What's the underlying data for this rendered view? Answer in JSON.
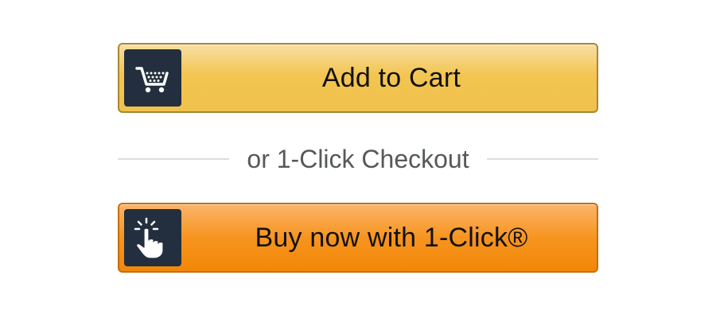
{
  "add_to_cart": {
    "label": "Add to Cart",
    "icon": "shopping-cart-icon"
  },
  "divider": {
    "text": "or 1-Click Checkout"
  },
  "buy_now": {
    "label": "Buy now with 1-Click®",
    "icon": "tap-hand-icon"
  },
  "colors": {
    "cart_button": "#f0c14b",
    "buy_button": "#f7941f",
    "icon_background": "#232f3e"
  }
}
